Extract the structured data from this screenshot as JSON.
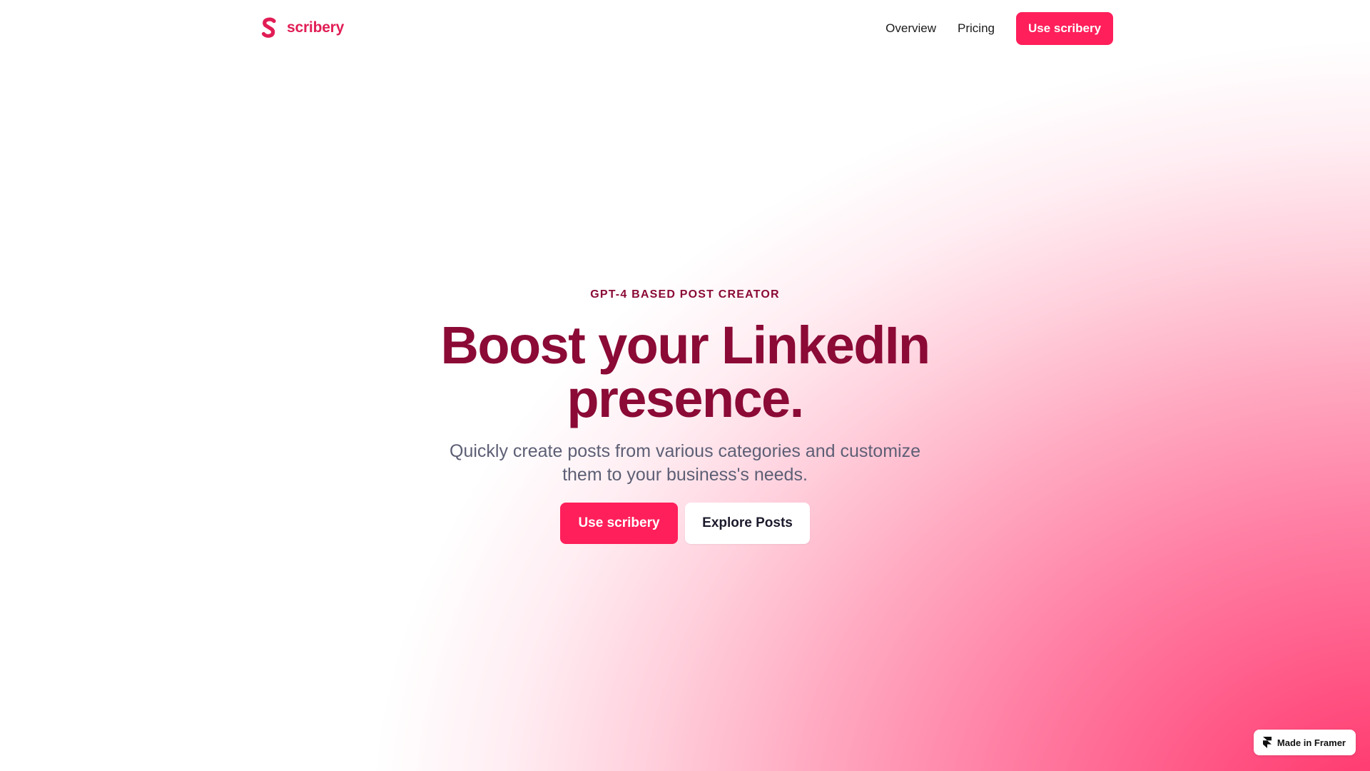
{
  "brand": {
    "name": "scribery",
    "logo_icon": "scribery-s-logo-icon",
    "accent_color": "#ff1f5a",
    "logo_color": "#e11d55"
  },
  "nav": {
    "links": [
      {
        "label": "Overview"
      },
      {
        "label": "Pricing"
      }
    ],
    "cta_label": "Use scribery"
  },
  "hero": {
    "eyebrow": "GPT-4 BASED POST CREATOR",
    "headline": "Boost your LinkedIn presence.",
    "subheadline": "Quickly create posts from various categories and customize them to your business's needs.",
    "primary_button": "Use scribery",
    "secondary_button": "Explore Posts",
    "headline_color": "#8b0a36",
    "subheadline_color": "#5d5f75"
  },
  "badge": {
    "label": "Made in Framer",
    "icon": "framer-logo-icon"
  }
}
